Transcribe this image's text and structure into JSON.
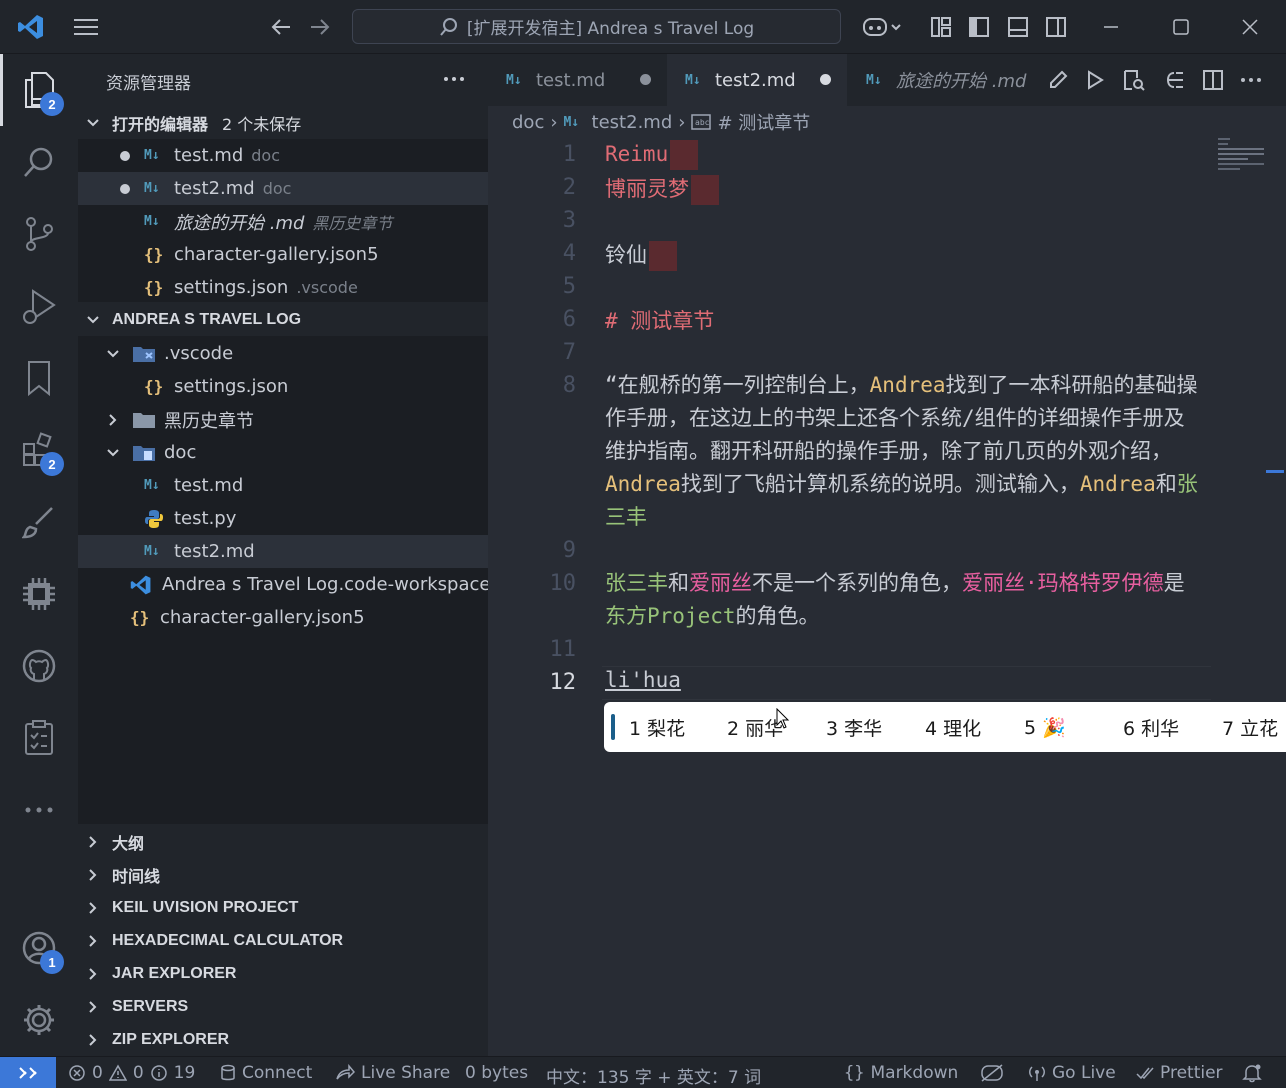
{
  "titlebar": {
    "title": "[扩展开发宿主] Andrea s Travel Log"
  },
  "activity": {
    "explorer_badge": "2",
    "extensions_badge": "2",
    "accounts_badge": "1"
  },
  "sidebar": {
    "header": "资源管理器",
    "open_editors": {
      "title": "打开的编辑器",
      "unsaved": "2 个未保存",
      "items": [
        {
          "name": "test.md",
          "desc": "doc"
        },
        {
          "name": "test2.md",
          "desc": "doc"
        },
        {
          "name": "旅途的开始 .md",
          "desc": "黑历史章节"
        },
        {
          "name": "character-gallery.json5",
          "desc": ""
        },
        {
          "name": "settings.json",
          "desc": ".vscode"
        }
      ]
    },
    "workspace": {
      "title": "ANDREA S TRAVEL LOG",
      "items": [
        {
          "name": ".vscode"
        },
        {
          "name": "settings.json"
        },
        {
          "name": "黑历史章节"
        },
        {
          "name": "doc"
        },
        {
          "name": "test.md"
        },
        {
          "name": "test.py"
        },
        {
          "name": "test2.md"
        },
        {
          "name": "Andrea s Travel Log.code-workspace"
        },
        {
          "name": "character-gallery.json5"
        }
      ]
    },
    "sections": [
      "大纲",
      "时间线",
      "KEIL UVISION PROJECT",
      "HEXADECIMAL CALCULATOR",
      "JAR EXPLORER",
      "SERVERS",
      "ZIP EXPLORER"
    ]
  },
  "tabs": [
    {
      "label": "test.md"
    },
    {
      "label": "test2.md"
    },
    {
      "label": "旅途的开始 .md"
    }
  ],
  "breadcrumb": {
    "folder": "doc",
    "file": "test2.md",
    "symbol": "# 测试章节"
  },
  "editor": {
    "line_numbers": [
      "1",
      "2",
      "3",
      "4",
      "5",
      "6",
      "7",
      "8",
      "9",
      "10",
      "11",
      "12"
    ],
    "l1": "Reimu",
    "l2": "博丽灵梦",
    "l4": "铃仙",
    "l6": "# 测试章节",
    "l8": {
      "a": "“在舰桥的第一列控制台上，",
      "andrea1": "Andrea",
      "b": "找到了一本科研船的基础操作手册，在这边上的书架上还各个系统/组件的详细操作手册及维护指南。翻开科研船的操作手册，除了前几页的外观介绍，",
      "andrea2": "Andrea",
      "c": "找到了飞船计算机系统的说明。测试输入，",
      "andrea3": "Andrea",
      "d": "和",
      "zhang": "张三丰"
    },
    "l10": {
      "zhang": "张三丰",
      "he": "和",
      "alice": "爱丽丝",
      "mid": "不是一个系列的角色，",
      "alice_full": "爱丽丝·玛格特罗伊德",
      "shi": "是",
      "touhou": "东方Project",
      "end": "的角色。"
    },
    "l12": "li'hua"
  },
  "ime": {
    "candidates": [
      "1 梨花",
      "2 丽华",
      "3 李华",
      "4 理化",
      "5 🎉",
      "6 利华",
      "7 立花"
    ]
  },
  "statusbar": {
    "errors": "0",
    "warnings": "0",
    "infos": "19",
    "connect": "Connect",
    "live_share": "Live Share",
    "bytes": "0 bytes",
    "word_count": "中文：135 字 + 英文：7 词",
    "language": "Markdown",
    "go_live": "Go Live",
    "prettier": "Prettier"
  }
}
